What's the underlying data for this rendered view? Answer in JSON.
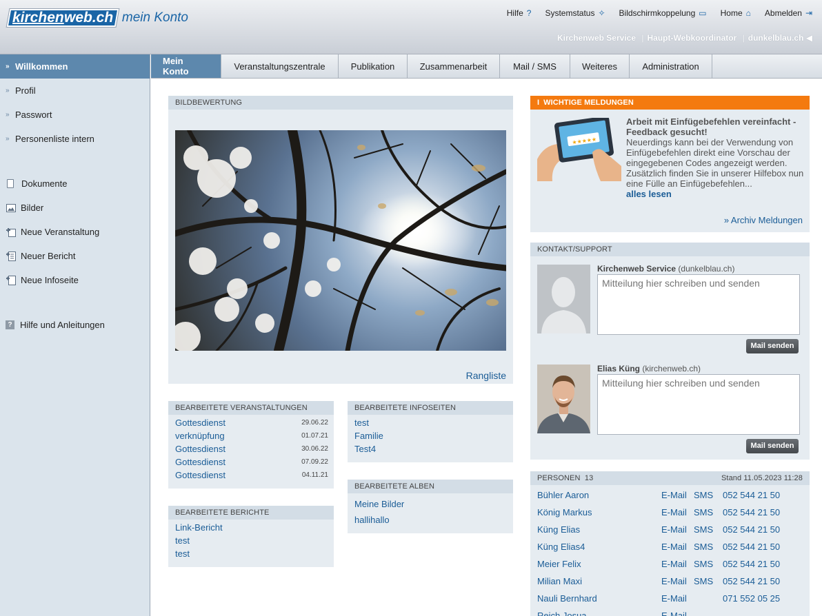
{
  "logo": {
    "part1": "kirchen",
    "part2": "web.ch",
    "subtitle": "mein Konto"
  },
  "topnav": [
    {
      "label": "Hilfe",
      "icon": "?"
    },
    {
      "label": "Systemstatus",
      "icon": "✧"
    },
    {
      "label": "Bildschirmkoppelung",
      "icon": "▭"
    },
    {
      "label": "Home",
      "icon": "⌂"
    },
    {
      "label": "Abmelden",
      "icon": "⇥"
    }
  ],
  "userline": {
    "service": "Kirchenweb Service",
    "role": "Haupt-Webkoordinator",
    "domain": "dunkelblau.ch",
    "sep": "|",
    "arrow": "◀"
  },
  "sidebar": {
    "items1": [
      "Willkommen",
      "Profil",
      "Passwort",
      "Personenliste intern"
    ],
    "items2": [
      "Dokumente",
      "Bilder",
      "Neue Veranstaltung",
      "Neuer Bericht",
      "Neue Infoseite"
    ],
    "help": "Hilfe und Anleitungen",
    "arrow": "»"
  },
  "tabs": [
    "Mein Konto",
    "Veranstaltungszentrale",
    "Publikation",
    "Zusammenarbeit",
    "Mail / SMS",
    "Weiteres",
    "Administration"
  ],
  "bildbewertung": {
    "title": "BILDBEWERTUNG",
    "link": "Rangliste"
  },
  "veranstaltungen": {
    "title": "BEARBEITETE VERANSTALTUNGEN",
    "rows": [
      {
        "name": "Gottesdienst",
        "date": "29.06.22"
      },
      {
        "name": "verknüpfung",
        "date": "01.07.21"
      },
      {
        "name": "Gottesdienst",
        "date": "30.06.22"
      },
      {
        "name": "Gottesdienst",
        "date": "07.09.22"
      },
      {
        "name": "Gottesdienst",
        "date": "04.11.21"
      }
    ]
  },
  "berichte": {
    "title": "BEARBEITETE BERICHTE",
    "rows": [
      "Link-Bericht",
      "test",
      "test"
    ]
  },
  "infoseiten": {
    "title": "BEARBEITETE INFOSEITEN",
    "rows": [
      "test",
      "Familie",
      "Test4"
    ]
  },
  "alben": {
    "title": "BEARBEITETE ALBEN",
    "rows": [
      "Meine Bilder",
      "hallihallo"
    ]
  },
  "meldungen": {
    "title": "WICHTIGE MELDUNGEN",
    "icon": "i",
    "headline": "Arbeit mit Einfügebefehlen vereinfacht - Feedback gesucht!",
    "body": "Neuerdings kann bei der Verwendung von Einfügebefehlen direkt eine Vorschau der eingegebenen Codes angezeigt werden. Zusätzlich finden Sie in unserer Hilfebox nun eine Fülle an Einfügebefehlen...",
    "more": "alles lesen",
    "archive": "» Archiv Meldungen",
    "stars": "★★★★★"
  },
  "kontakt": {
    "title": "KONTAKT/SUPPORT",
    "contacts": [
      {
        "name": "Kirchenweb Service",
        "org": "(dunkelblau.ch)",
        "placeholder": "Mitteilung hier schreiben und senden",
        "button": "Mail senden"
      },
      {
        "name": "Elias Küng",
        "org": "(kirchenweb.ch)",
        "placeholder": "Mitteilung hier schreiben und senden",
        "button": "Mail senden"
      }
    ]
  },
  "personen": {
    "title": "PERSONEN",
    "count": "13",
    "stand": "Stand 11.05.2023 11:28",
    "rows": [
      {
        "name": "Bühler Aaron",
        "email": "E-Mail",
        "sms": "SMS",
        "phone": "052 544 21 50"
      },
      {
        "name": "König Markus",
        "email": "E-Mail",
        "sms": "SMS",
        "phone": "052 544 21 50"
      },
      {
        "name": "Küng Elias",
        "email": "E-Mail",
        "sms": "SMS",
        "phone": "052 544 21 50"
      },
      {
        "name": "Küng Elias4",
        "email": "E-Mail",
        "sms": "SMS",
        "phone": "052 544 21 50"
      },
      {
        "name": "Meier Felix",
        "email": "E-Mail",
        "sms": "SMS",
        "phone": "052 544 21 50"
      },
      {
        "name": "Milian Maxi",
        "email": "E-Mail",
        "sms": "SMS",
        "phone": "052 544 21 50"
      },
      {
        "name": "Nauli Bernhard",
        "email": "E-Mail",
        "sms": "",
        "phone": "071 552 05 25"
      },
      {
        "name": "Reich Josua",
        "email": "E-Mail",
        "sms": "",
        "phone": ""
      }
    ]
  },
  "colors": {
    "accent": "#5d88ad",
    "link": "#1a5c96",
    "orange": "#f47a0f",
    "panel": "#e6ecf1"
  }
}
